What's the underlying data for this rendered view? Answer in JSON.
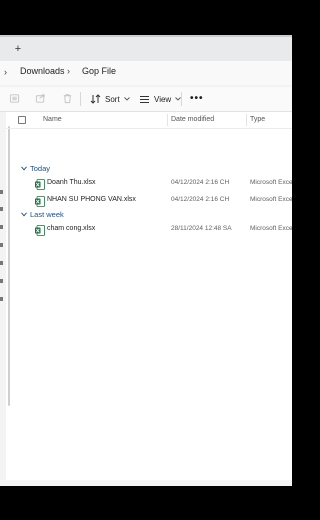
{
  "tabbar": {
    "new_tab": "+"
  },
  "breadcrumb": {
    "items": [
      "Downloads",
      "Gop File"
    ]
  },
  "toolbar": {
    "sort_label": "Sort",
    "view_label": "View",
    "more_label": "•••"
  },
  "columns": {
    "name": "Name",
    "date": "Date modified",
    "type": "Type"
  },
  "groups": [
    {
      "label": "Today",
      "files": [
        {
          "name": "Doanh Thu.xlsx",
          "date": "04/12/2024 2:16 CH",
          "type": "Microsoft Exce"
        },
        {
          "name": "NHAN SU PHONG VAN.xlsx",
          "date": "04/12/2024 2:16 CH",
          "type": "Microsoft Exce"
        }
      ]
    },
    {
      "label": "Last week",
      "files": [
        {
          "name": "cham cong.xlsx",
          "date": "28/11/2024 12:48 SA",
          "type": "Microsoft Exce"
        }
      ]
    }
  ]
}
